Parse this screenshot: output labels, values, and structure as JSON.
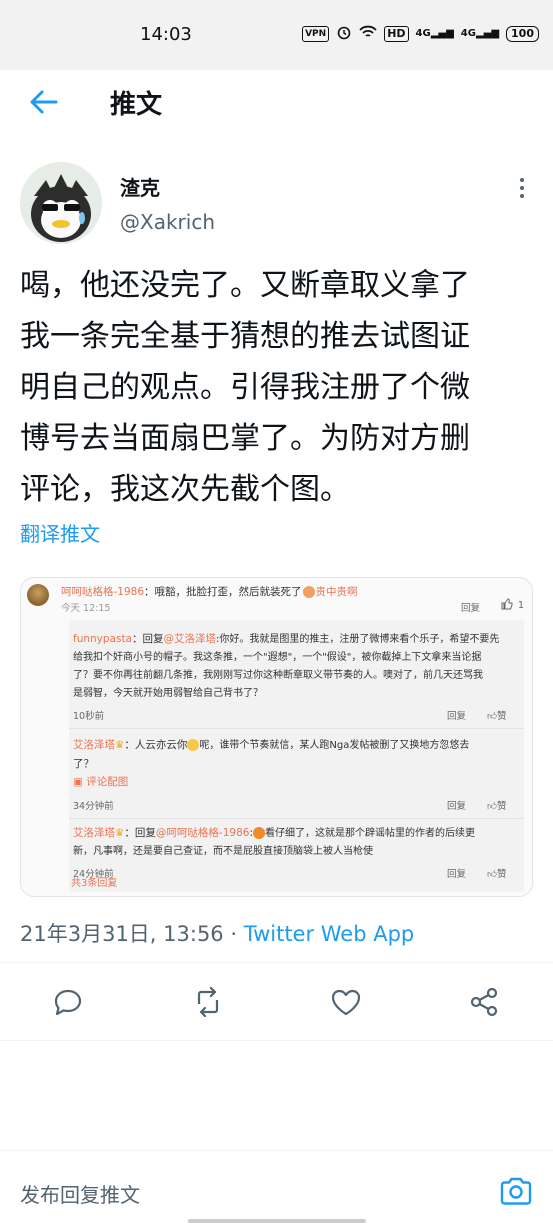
{
  "status_bar": {
    "time": "14:03",
    "vpn": "VPN",
    "hd": "HD",
    "signal1": "4G",
    "signal2": "4G",
    "battery": "100"
  },
  "header": {
    "title": "推文"
  },
  "author": {
    "name": "渣克",
    "handle": "@Xakrich"
  },
  "tweet": {
    "lines": [
      "喝，他还没完了。又断章取义拿了",
      "我一条完全基于猜想的推去试图证",
      "明自己的观点。引得我注册了个微",
      "博号去当面扇巴掌了。为防对方删",
      "评论，我这次先截个图。"
    ],
    "translate": "翻译推文",
    "timestamp": "21年3月31日, 13:56",
    "dot": " · ",
    "source": "Twitter Web App"
  },
  "screenshot": {
    "top_comment": {
      "user": "呵呵哒格格-1986",
      "text": "：哦豁，批脸打歪，然后就装死了",
      "emoji_text": "贵中贵啊",
      "time": "今天 12:15",
      "reply": "回复",
      "likes": "1"
    },
    "replies": [
      {
        "user": "funnypasta",
        "prefix": "：回复",
        "mention": "@艾洛泽塔",
        "text_line1": ":你好。我就是图里的推主，注册了微博来看个乐子，希望不要先",
        "text_line2": "给我扣个奸商小号的帽子。我这条推，一个\"遐想\"，一个\"假设\"，被你截掉上下文拿来当论据",
        "text_line3": "了？要不你再往前翻几条推，我刚刚写过你这种断章取义带节奏的人。噢对了，前几天还骂我",
        "text_line4": "是弱智，今天就开始用弱智给自己背书了？",
        "time": "10秒前",
        "reply": "回复",
        "like": "赞"
      },
      {
        "user": "艾洛泽塔",
        "text_line1": "：人云亦云你",
        "text_line1b": "呢，谁带个节奏就信，某人跑Nga发帖被删了又换地方忽悠去",
        "text_line2": "了？",
        "image_label": "评论配图",
        "time": "34分钟前",
        "reply": "回复",
        "like": "赞"
      },
      {
        "user": "艾洛泽塔",
        "prefix": "：回复",
        "mention": "@呵呵哒格格-1986",
        "text_line1": ":",
        "text_line1b": "看仔细了，这就是那个辟谣帖里的作者的后续更",
        "text_line2": "新，凡事啊，还是要自己查证，而不是屁股直接顶脑袋上被人当枪使",
        "time": "24分钟前",
        "reply": "回复",
        "like": "赞"
      }
    ],
    "more_replies": "共3条回复"
  },
  "reply_bar": {
    "placeholder": "发布回复推文"
  },
  "colors": {
    "accent": "#1d9bf0",
    "weibo_user": "#eb7350",
    "text": "#0f1419",
    "muted": "#536471"
  },
  "icons": [
    "back-arrow-icon",
    "more-vertical-icon",
    "reply-icon",
    "retweet-icon",
    "like-icon",
    "share-icon",
    "camera-icon"
  ]
}
